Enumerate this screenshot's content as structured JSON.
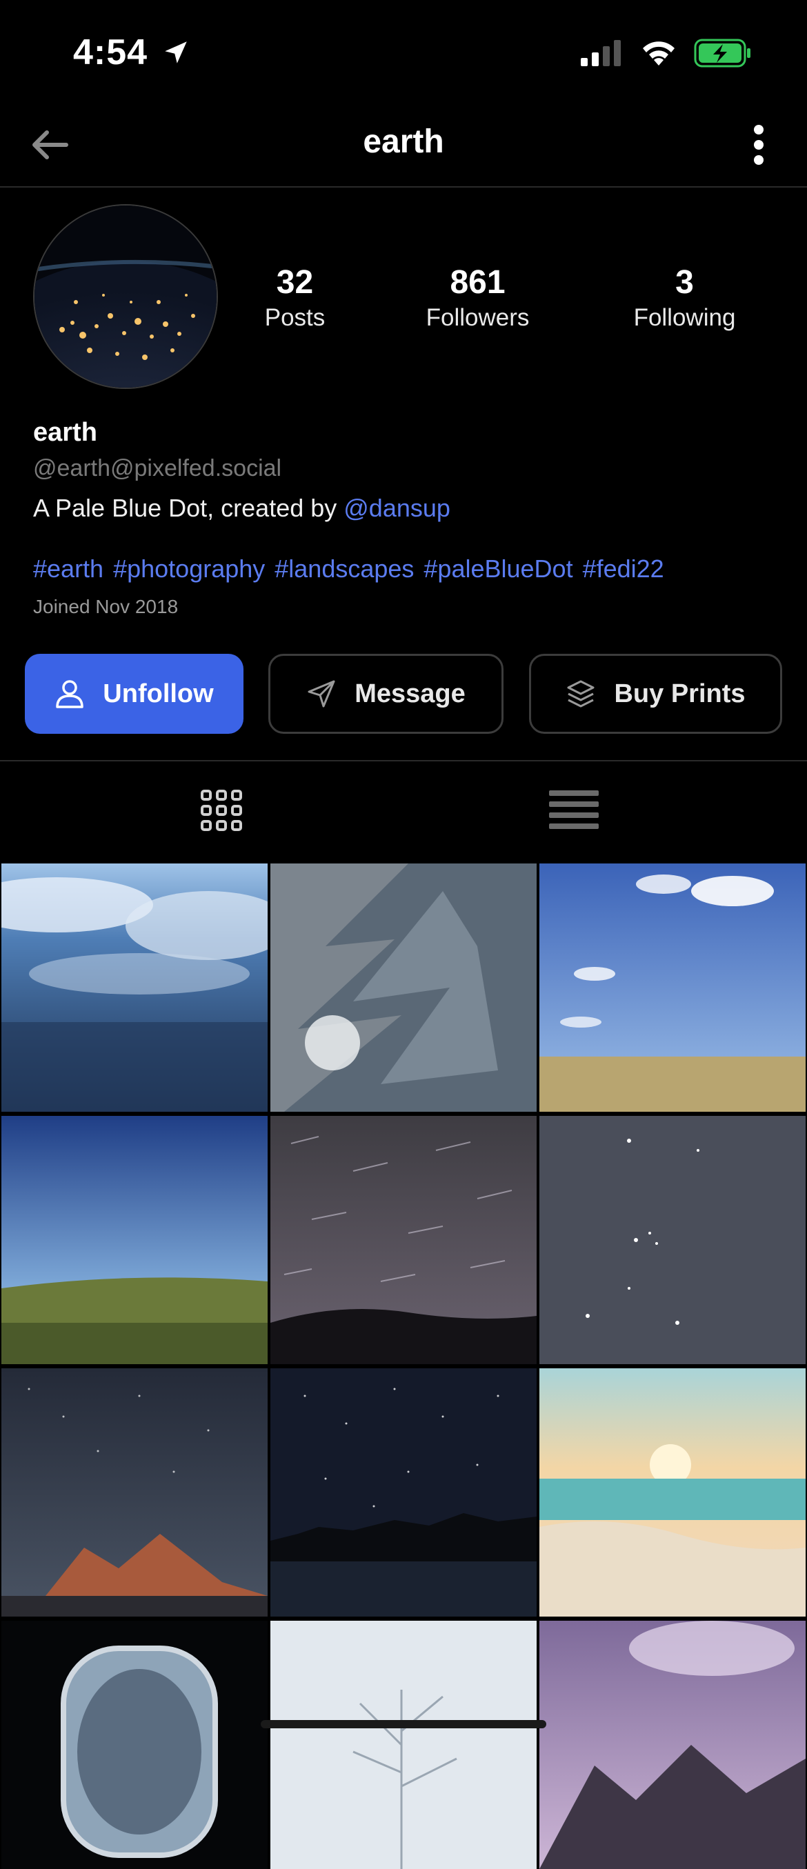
{
  "status_bar": {
    "time": "4:54"
  },
  "nav": {
    "title": "earth"
  },
  "profile": {
    "stats": [
      {
        "value": "32",
        "label": "Posts"
      },
      {
        "value": "861",
        "label": "Followers"
      },
      {
        "value": "3",
        "label": "Following"
      }
    ],
    "display_name": "earth",
    "handle": "@earth@pixelfed.social",
    "bio_text": "A Pale Blue Dot, created by ",
    "bio_mention": "@dansup",
    "hashtags": "#earth #photography #landscapes #paleBlueDot #fedi22",
    "joined": "Joined Nov 2018"
  },
  "actions": {
    "unfollow_label": "Unfollow",
    "message_label": "Message",
    "buy_prints_label": "Buy Prints"
  },
  "colors": {
    "accent": "#3b63e6",
    "link": "#5b7cf0",
    "background": "#000000"
  }
}
